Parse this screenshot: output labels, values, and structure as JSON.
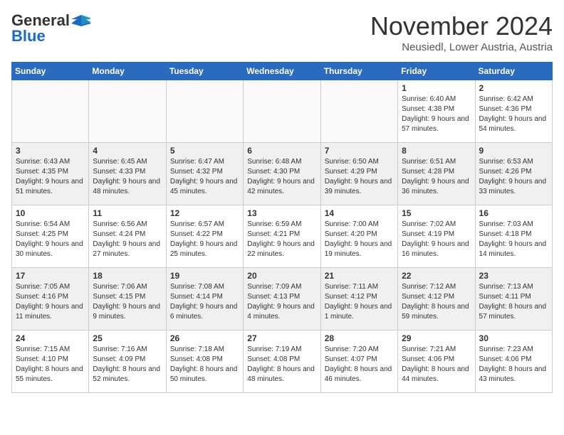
{
  "logo": {
    "general": "General",
    "blue": "Blue"
  },
  "header": {
    "month": "November 2024",
    "location": "Neusiedl, Lower Austria, Austria"
  },
  "weekdays": [
    "Sunday",
    "Monday",
    "Tuesday",
    "Wednesday",
    "Thursday",
    "Friday",
    "Saturday"
  ],
  "weeks": [
    [
      {
        "day": "",
        "info": ""
      },
      {
        "day": "",
        "info": ""
      },
      {
        "day": "",
        "info": ""
      },
      {
        "day": "",
        "info": ""
      },
      {
        "day": "",
        "info": ""
      },
      {
        "day": "1",
        "info": "Sunrise: 6:40 AM\nSunset: 4:38 PM\nDaylight: 9 hours and 57 minutes."
      },
      {
        "day": "2",
        "info": "Sunrise: 6:42 AM\nSunset: 4:36 PM\nDaylight: 9 hours and 54 minutes."
      }
    ],
    [
      {
        "day": "3",
        "info": "Sunrise: 6:43 AM\nSunset: 4:35 PM\nDaylight: 9 hours and 51 minutes."
      },
      {
        "day": "4",
        "info": "Sunrise: 6:45 AM\nSunset: 4:33 PM\nDaylight: 9 hours and 48 minutes."
      },
      {
        "day": "5",
        "info": "Sunrise: 6:47 AM\nSunset: 4:32 PM\nDaylight: 9 hours and 45 minutes."
      },
      {
        "day": "6",
        "info": "Sunrise: 6:48 AM\nSunset: 4:30 PM\nDaylight: 9 hours and 42 minutes."
      },
      {
        "day": "7",
        "info": "Sunrise: 6:50 AM\nSunset: 4:29 PM\nDaylight: 9 hours and 39 minutes."
      },
      {
        "day": "8",
        "info": "Sunrise: 6:51 AM\nSunset: 4:28 PM\nDaylight: 9 hours and 36 minutes."
      },
      {
        "day": "9",
        "info": "Sunrise: 6:53 AM\nSunset: 4:26 PM\nDaylight: 9 hours and 33 minutes."
      }
    ],
    [
      {
        "day": "10",
        "info": "Sunrise: 6:54 AM\nSunset: 4:25 PM\nDaylight: 9 hours and 30 minutes."
      },
      {
        "day": "11",
        "info": "Sunrise: 6:56 AM\nSunset: 4:24 PM\nDaylight: 9 hours and 27 minutes."
      },
      {
        "day": "12",
        "info": "Sunrise: 6:57 AM\nSunset: 4:22 PM\nDaylight: 9 hours and 25 minutes."
      },
      {
        "day": "13",
        "info": "Sunrise: 6:59 AM\nSunset: 4:21 PM\nDaylight: 9 hours and 22 minutes."
      },
      {
        "day": "14",
        "info": "Sunrise: 7:00 AM\nSunset: 4:20 PM\nDaylight: 9 hours and 19 minutes."
      },
      {
        "day": "15",
        "info": "Sunrise: 7:02 AM\nSunset: 4:19 PM\nDaylight: 9 hours and 16 minutes."
      },
      {
        "day": "16",
        "info": "Sunrise: 7:03 AM\nSunset: 4:18 PM\nDaylight: 9 hours and 14 minutes."
      }
    ],
    [
      {
        "day": "17",
        "info": "Sunrise: 7:05 AM\nSunset: 4:16 PM\nDaylight: 9 hours and 11 minutes."
      },
      {
        "day": "18",
        "info": "Sunrise: 7:06 AM\nSunset: 4:15 PM\nDaylight: 9 hours and 9 minutes."
      },
      {
        "day": "19",
        "info": "Sunrise: 7:08 AM\nSunset: 4:14 PM\nDaylight: 9 hours and 6 minutes."
      },
      {
        "day": "20",
        "info": "Sunrise: 7:09 AM\nSunset: 4:13 PM\nDaylight: 9 hours and 4 minutes."
      },
      {
        "day": "21",
        "info": "Sunrise: 7:11 AM\nSunset: 4:12 PM\nDaylight: 9 hours and 1 minute."
      },
      {
        "day": "22",
        "info": "Sunrise: 7:12 AM\nSunset: 4:12 PM\nDaylight: 8 hours and 59 minutes."
      },
      {
        "day": "23",
        "info": "Sunrise: 7:13 AM\nSunset: 4:11 PM\nDaylight: 8 hours and 57 minutes."
      }
    ],
    [
      {
        "day": "24",
        "info": "Sunrise: 7:15 AM\nSunset: 4:10 PM\nDaylight: 8 hours and 55 minutes."
      },
      {
        "day": "25",
        "info": "Sunrise: 7:16 AM\nSunset: 4:09 PM\nDaylight: 8 hours and 52 minutes."
      },
      {
        "day": "26",
        "info": "Sunrise: 7:18 AM\nSunset: 4:08 PM\nDaylight: 8 hours and 50 minutes."
      },
      {
        "day": "27",
        "info": "Sunrise: 7:19 AM\nSunset: 4:08 PM\nDaylight: 8 hours and 48 minutes."
      },
      {
        "day": "28",
        "info": "Sunrise: 7:20 AM\nSunset: 4:07 PM\nDaylight: 8 hours and 46 minutes."
      },
      {
        "day": "29",
        "info": "Sunrise: 7:21 AM\nSunset: 4:06 PM\nDaylight: 8 hours and 44 minutes."
      },
      {
        "day": "30",
        "info": "Sunrise: 7:23 AM\nSunset: 4:06 PM\nDaylight: 8 hours and 43 minutes."
      }
    ]
  ]
}
